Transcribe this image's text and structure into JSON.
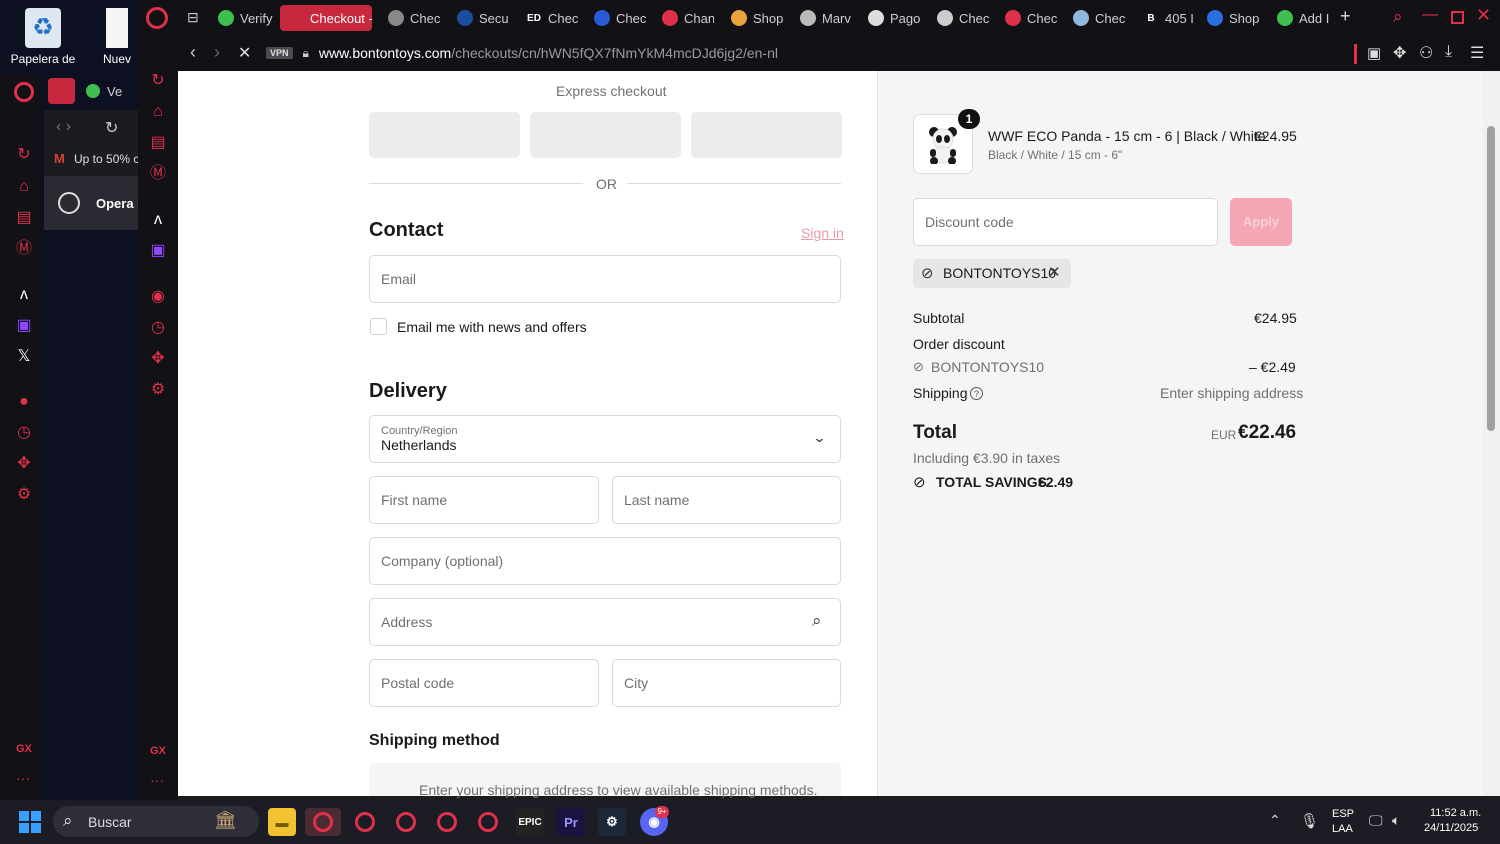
{
  "desktop": {
    "icons": [
      {
        "label": "Papelera de"
      },
      {
        "label": "Nuev"
      }
    ]
  },
  "second_window": {
    "tab_label": "Ve",
    "mail_text": "Up to 50% c",
    "opera_label": "Opera s"
  },
  "tabs": [
    {
      "label": "Verify",
      "color": "#3fbf4f"
    },
    {
      "label": "Checkout -",
      "color": "#c7283d",
      "active": true
    },
    {
      "label": "Chec",
      "color": "#888888"
    },
    {
      "label": "Secu",
      "color": "#1b4f9c"
    },
    {
      "label": "Chec",
      "color": "#ffffff",
      "prefix": "ED"
    },
    {
      "label": "Chec",
      "color": "#2a5bd7"
    },
    {
      "label": "Chan",
      "color": "#e0304a"
    },
    {
      "label": "Shop",
      "color": "#e8a33b"
    },
    {
      "label": "Marv",
      "color": "#bbbbbb"
    },
    {
      "label": "Pago",
      "color": "#dddddd"
    },
    {
      "label": "Chec",
      "color": "#cccccc"
    },
    {
      "label": "Chec",
      "color": "#e0304a"
    },
    {
      "label": "Chec",
      "color": "#8fb8e0"
    },
    {
      "label": "405 I",
      "color": "#ffffff",
      "prefix": "B"
    },
    {
      "label": "Shop",
      "color": "#2a6fe0"
    },
    {
      "label": "Add I",
      "color": "#3fbf4f"
    }
  ],
  "address": {
    "vpn": "VPN",
    "url_host": "www.bontontoys.com",
    "url_path": "/checkouts/cn/hWN5fQX7fNmYkM4mcDJd6jg2/en-nl"
  },
  "checkout": {
    "express_label": "Express checkout",
    "or_label": "OR",
    "contact_heading": "Contact",
    "sign_in": "Sign in",
    "email_placeholder": "Email",
    "news_label": "Email me with news and offers",
    "delivery_heading": "Delivery",
    "country_label": "Country/Region",
    "country_value": "Netherlands",
    "first_name": "First name",
    "last_name": "Last name",
    "company": "Company (optional)",
    "address": "Address",
    "postal": "Postal code",
    "city": "City",
    "shipping_heading": "Shipping method",
    "shipping_note": "Enter your shipping address to view available shipping methods."
  },
  "summary": {
    "qty": "1",
    "product_name": "WWF ECO Panda - 15 cm - 6 | Black / White",
    "product_variant": "Black / White / 15 cm - 6\"",
    "product_price": "€24.95",
    "discount_placeholder": "Discount code",
    "apply": "Apply",
    "applied_code": "BONTONTOYS10",
    "subtotal_label": "Subtotal",
    "subtotal_value": "€24.95",
    "order_discount_label": "Order discount",
    "discount_code_line": "BONTONTOYS10",
    "discount_value": "– €2.49",
    "shipping_label": "Shipping",
    "shipping_value": "Enter shipping address",
    "total_label": "Total",
    "currency": "EUR",
    "total_value": "€22.46",
    "taxes": "Including €3.90 in taxes",
    "savings_label": "TOTAL SAVINGS",
    "savings_value": "€2.49"
  },
  "taskbar": {
    "search": "Buscar",
    "lang_top": "ESP",
    "lang_bottom": "LAA",
    "time": "11:52 a.m.",
    "date": "24/11/2025",
    "discord_badge": "9+"
  }
}
